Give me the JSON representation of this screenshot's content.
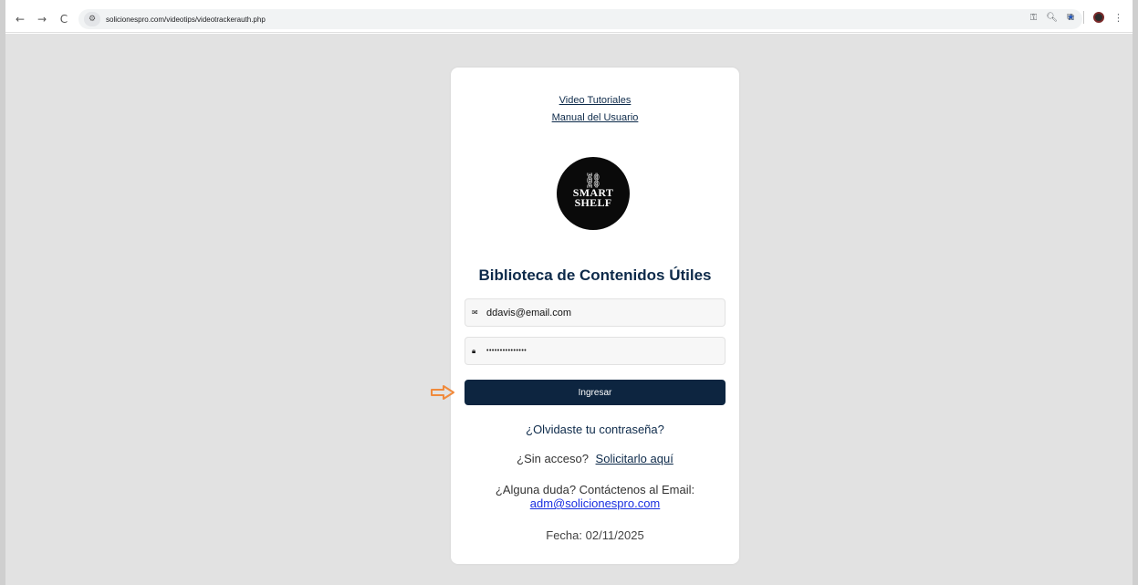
{
  "browser": {
    "url": "solicionespro.com/videotips/videotrackerauth.php",
    "icons": {
      "back": "back-arrow-icon",
      "forward": "forward-arrow-icon",
      "reload": "reload-icon",
      "site_settings": "tune-icon",
      "key": "key-icon",
      "zoom": "zoom-icon",
      "bookmark": "star-icon",
      "extensions": "puzzle-icon",
      "menu": "kebab-menu-icon"
    },
    "glyphs": {
      "back": "←",
      "forward": "→",
      "reload": "C",
      "tune": "⚙",
      "key": "⚿",
      "zoom": "🔍︎",
      "star": "★",
      "extensions": "⧉",
      "menu": "⋮"
    }
  },
  "card": {
    "links": {
      "video_tutorials": "Video Tutoriales",
      "user_manual": "Manual del Usuario"
    },
    "logo": {
      "line1": "SMART",
      "line2": "SHELF",
      "chain": "⛓"
    },
    "title": "Biblioteca de Contenidos Útiles",
    "email_field": {
      "value": "ddavis@email.com",
      "icon": "envelope-icon",
      "glyph": "✉"
    },
    "password_field": {
      "value": "•••••••••••••••",
      "icon": "lock-icon",
      "glyph": "🔒︎"
    },
    "login_button": "Ingresar",
    "forgot_password": "¿Olvidaste tu contraseña?",
    "no_access_prefix": "¿Sin acceso?",
    "no_access_link": "Solicitarlo aquí",
    "contact_text": "¿Alguna duda? Contáctenos al Email:",
    "contact_email": "adm@solicionespro.com",
    "date_label": "Fecha: 02/11/2025"
  },
  "colors": {
    "brand_navy": "#0d2540",
    "page_bg": "#e2e2e2",
    "annotation_arrow": "#f08a3c",
    "email_link": "#1a2fe0"
  }
}
